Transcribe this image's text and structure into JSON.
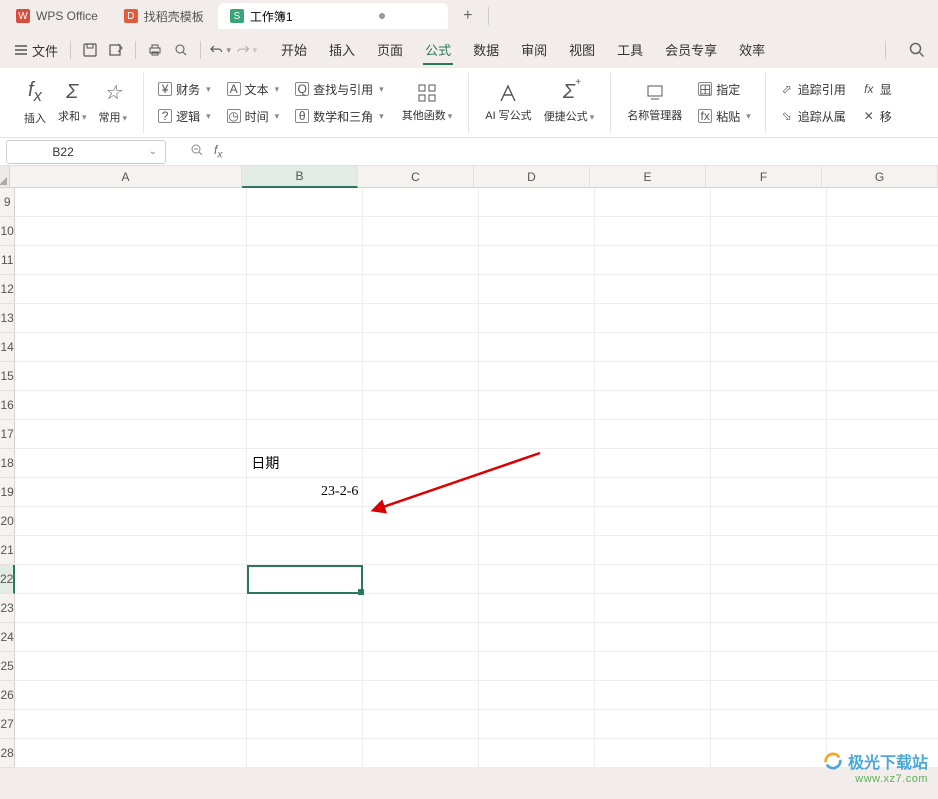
{
  "tabs": {
    "wps": "WPS Office",
    "template": "找稻壳模板",
    "workbook": "工作簿1"
  },
  "menu": {
    "file": "文件",
    "items": [
      "开始",
      "插入",
      "页面",
      "公式",
      "数据",
      "审阅",
      "视图",
      "工具",
      "会员专享",
      "效率"
    ],
    "active_index": 3
  },
  "ribbon": {
    "insert": "插入",
    "sum": "求和",
    "common": "常用",
    "finance": "财务",
    "text": "文本",
    "lookup": "查找与引用",
    "logic": "逻辑",
    "time": "时间",
    "math": "数学和三角",
    "other": "其他函数",
    "ai": "AI 写公式",
    "quick": "便捷公式",
    "namemgr": "名称管理器",
    "paste": "粘贴",
    "define": "指定",
    "trace_ref": "追踪引用",
    "trace_dep": "追踪从属",
    "show": "显",
    "move": "移"
  },
  "namebox": "B22",
  "columns": [
    "A",
    "B",
    "C",
    "D",
    "E",
    "F",
    "G"
  ],
  "rows": [
    "9",
    "10",
    "11",
    "12",
    "13",
    "14",
    "15",
    "16",
    "17",
    "18",
    "19",
    "20",
    "21",
    "22",
    "23",
    "24",
    "25",
    "26",
    "27",
    "28"
  ],
  "cell_b18": "日期",
  "cell_b19": "23-2-6",
  "selected_col_index": 1,
  "selected_row_index": 13,
  "watermark": {
    "text": "极光下载站",
    "url": "www.xz7.com"
  }
}
